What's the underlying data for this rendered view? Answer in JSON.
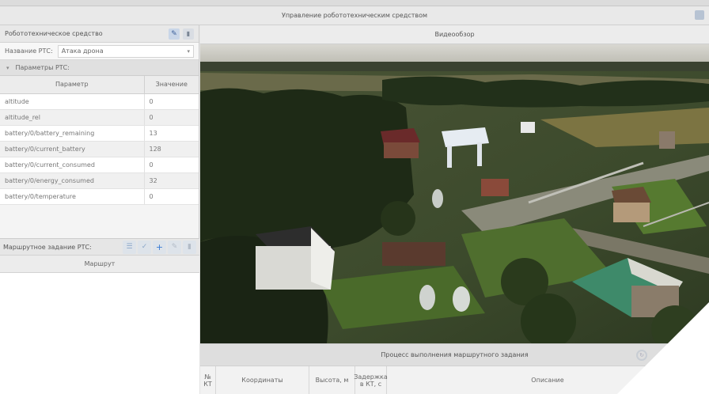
{
  "window": {
    "title": "Управление робототехническим средством"
  },
  "left_panel": {
    "title": "Робототехническое средство",
    "rtc_label": "Название РТС:",
    "rtc_value": "Атака дрона",
    "params_group": "Параметры РТС:",
    "columns": [
      "Параметр",
      "Значение"
    ],
    "rows": [
      {
        "param": "altitude",
        "value": "0"
      },
      {
        "param": "altitude_rel",
        "value": "0"
      },
      {
        "param": "battery/0/battery_remaining",
        "value": "13"
      },
      {
        "param": "battery/0/current_battery",
        "value": "128"
      },
      {
        "param": "battery/0/current_consumed",
        "value": "0"
      },
      {
        "param": "battery/0/energy_consumed",
        "value": "32"
      },
      {
        "param": "battery/0/temperature",
        "value": "0"
      }
    ]
  },
  "route_panel": {
    "title": "Маршрутное задание РТС:",
    "column": "Маршрут"
  },
  "video_panel": {
    "title": "Видеообзор"
  },
  "process_panel": {
    "title": "Процесс выполнения маршрутного задания",
    "columns": [
      {
        "label": "№ КТ"
      },
      {
        "label": "Координаты"
      },
      {
        "label": "Высота, м"
      },
      {
        "label": "Задержка в КТ, с"
      },
      {
        "label": "Описание"
      }
    ]
  },
  "icons": {
    "edit": "pencil-icon",
    "delete": "trash-icon",
    "add": "plus-icon",
    "confirm": "check-icon",
    "collapse": "chevron-down-icon",
    "refresh": "refresh-icon"
  },
  "colors": {
    "accent": "#3a7bd5",
    "panel_bg": "#f4f4f4",
    "header_bg": "#e8e8e8"
  }
}
